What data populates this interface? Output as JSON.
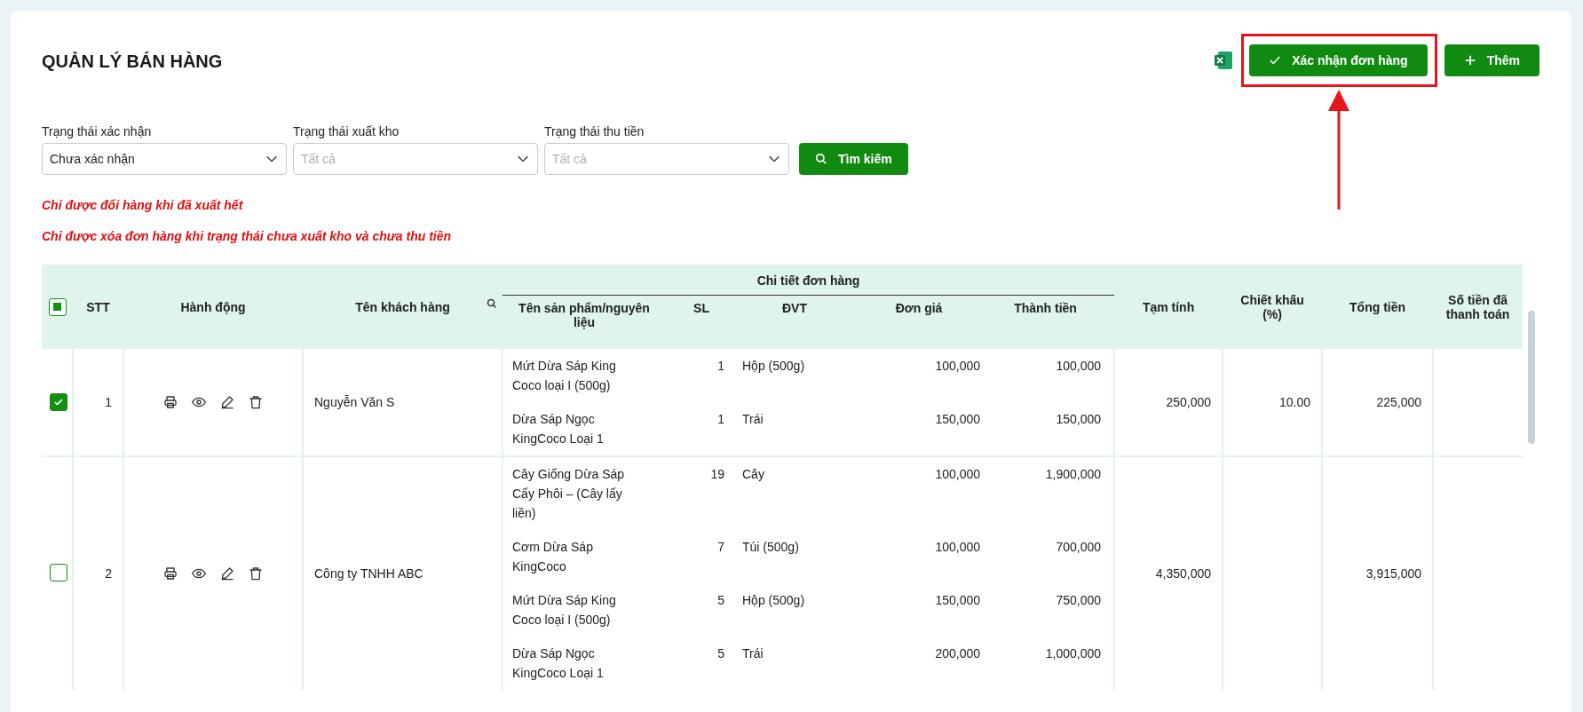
{
  "title": "QUẢN LÝ BÁN HÀNG",
  "actions": {
    "confirm": "Xác nhận đơn hàng",
    "add": "Thêm"
  },
  "filters": [
    {
      "label": "Trạng thái xác nhận",
      "value": "Chưa xác nhận"
    },
    {
      "label": "Trạng thái xuất kho",
      "placeholder": "Tất cả"
    },
    {
      "label": "Trạng thái thu tiền",
      "placeholder": "Tất cả"
    }
  ],
  "search_button": "Tìm kiếm",
  "notes": [
    "Chỉ được đổi hàng khi đã xuất hết",
    "Chỉ được xóa đơn hàng khi trạng thái chưa xuất kho và chưa thu tiền"
  ],
  "table": {
    "select_all": {
      "indeterminate": true
    },
    "columns": {
      "stt": "STT",
      "actions": "Hành động",
      "customer": "Tên khách hàng",
      "details": "Chi tiết đơn hàng",
      "product": "Tên sản phẩm/nguyên liệu",
      "qty": "SL",
      "unit": "ĐVT",
      "price": "Đơn giá",
      "amount": "Thành tiền",
      "subtotal": "Tạm tính",
      "discount": "Chiết khấu (%)",
      "total": "Tổng tiền",
      "paid": "Số tiền đã thanh toán"
    },
    "rows": [
      {
        "selected": true,
        "stt": "1",
        "customer": "Nguyễn Văn S",
        "subtotal": "250,000",
        "discount": "10.00",
        "total": "225,000",
        "items": [
          {
            "name": "Mứt Dừa Sáp King Coco loại I (500g)",
            "qty": "1",
            "unit": "Hộp (500g)",
            "price": "100,000",
            "amount": "100,000"
          },
          {
            "name": "Dừa Sáp Ngọc KingCoco Loại 1",
            "qty": "1",
            "unit": "Trái",
            "price": "150,000",
            "amount": "150,000"
          }
        ]
      },
      {
        "selected": false,
        "stt": "2",
        "customer": "Công ty TNHH ABC",
        "subtotal": "4,350,000",
        "total": "3,915,000",
        "items": [
          {
            "name": "Cây Giống Dừa Sáp Cấy Phôi – (Cây lấy liền)",
            "qty": "19",
            "unit": "Cây",
            "price": "100,000",
            "amount": "1,900,000"
          },
          {
            "name": "Cơm Dừa Sáp KingCoco",
            "qty": "7",
            "unit": "Túi (500g)",
            "price": "100,000",
            "amount": "700,000"
          },
          {
            "name": "Mứt Dừa Sáp King Coco loại I (500g)",
            "qty": "5",
            "unit": "Hộp (500g)",
            "price": "150,000",
            "amount": "750,000"
          },
          {
            "name": "Dừa Sáp Ngọc KingCoco Loại 1",
            "qty": "5",
            "unit": "Trái",
            "price": "200,000",
            "amount": "1,000,000"
          }
        ]
      }
    ]
  }
}
